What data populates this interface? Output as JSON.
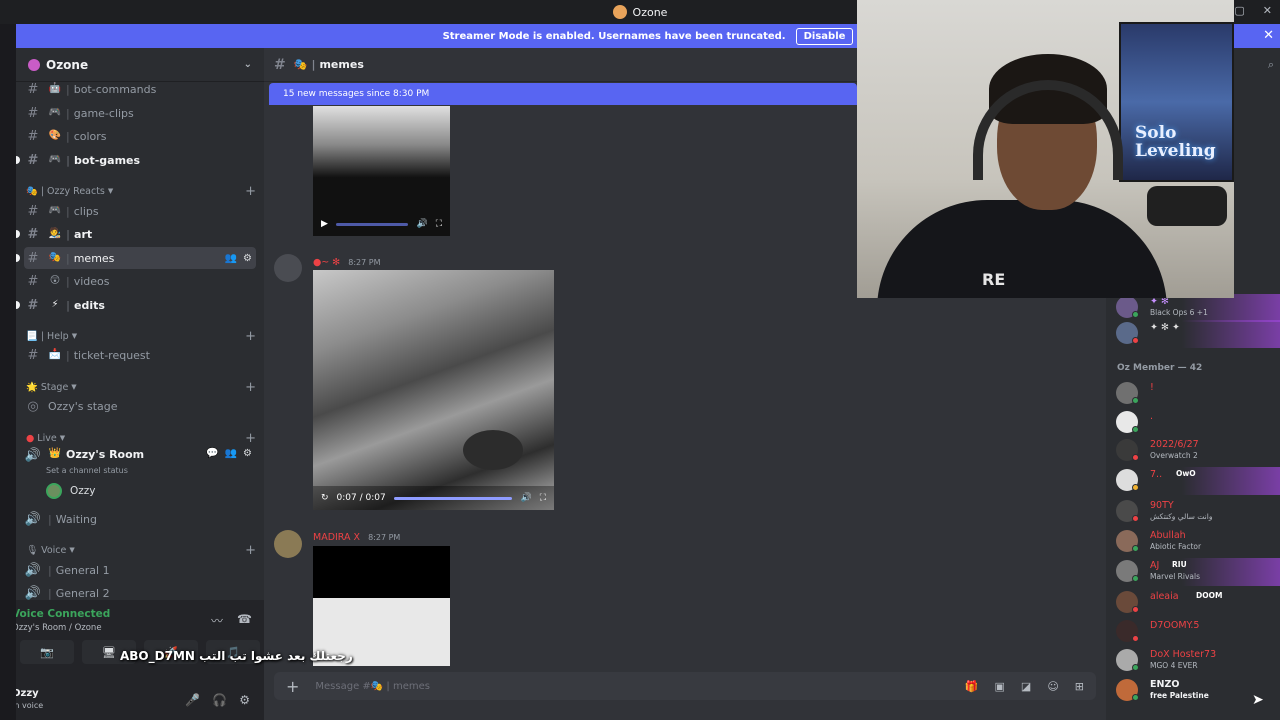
{
  "window": {
    "title": "Ozone"
  },
  "banner": {
    "text": "Streamer Mode is enabled. Usernames have been truncated.",
    "disable_label": "Disable"
  },
  "server": {
    "name": "Ozone"
  },
  "channels": {
    "bot_commands": "bot-commands",
    "game_clips": "game-clips",
    "colors": "colors",
    "bot_games": "bot-games",
    "cat_ozzy_reacts": "Ozzy Reacts",
    "clips": "clips",
    "art": "art",
    "memes": "memes",
    "videos": "videos",
    "edits": "edits",
    "cat_help": "Help",
    "ticket_request": "ticket-request",
    "cat_stage": "Stage",
    "ozzys_stage": "Ozzy's stage",
    "cat_live": "Live",
    "ozzys_room": "Ozzy's Room",
    "room_status": "Set a channel status",
    "voice_user": "Ozzy",
    "waiting": "Waiting",
    "cat_voice": "Voice",
    "general1": "General 1",
    "general2": "General 2"
  },
  "voice_panel": {
    "status": "Voice Connected",
    "location": "Ozzy's Room / Ozone",
    "user_name": "Ozzy",
    "user_status": "In voice"
  },
  "caption": "ABO_D7MN رجعتلك بعد عشوا تب التب",
  "chat": {
    "channel": "memes",
    "new_messages": "15 new messages since 8:30 PM",
    "msg1_time": "8:27 PM",
    "video1_time": "0:07 / 0:07",
    "msg2_author": "MADIRA X",
    "msg2_time": "8:27 PM",
    "composer_placeholder": "Message #🎭 | memes"
  },
  "members": {
    "section_header": "Oz Member — 42",
    "top1_activity": "Black Ops 6 +1",
    "list": [
      {
        "name": "!",
        "activity": ""
      },
      {
        "name": ".",
        "activity": ""
      },
      {
        "name": "2022/6/27",
        "activity": "Overwatch 2"
      },
      {
        "name": "7..",
        "activity": "",
        "badge": "OwO"
      },
      {
        "name": "90TY",
        "activity": "وانت سالي وكنتكش"
      },
      {
        "name": "Abullah",
        "activity": "Abiotic Factor"
      },
      {
        "name": "AJ",
        "activity": "Marvel Rivals",
        "badge": "RIU"
      },
      {
        "name": "aleaia",
        "activity": "",
        "badge": "DOOM"
      },
      {
        "name": "D7OOMY.5",
        "activity": ""
      },
      {
        "name": "DoX Hoster73",
        "activity": "MGO 4 EVER"
      },
      {
        "name": "ENZO",
        "activity": "free Palestine"
      }
    ]
  },
  "webcam": {
    "poster_line1": "Solo",
    "poster_line2": "Leveling",
    "shirt_logo": "RE"
  },
  "colors": {
    "accent": "#5865f2",
    "sidebar": "#2b2d31",
    "chat_bg": "#313338",
    "voice_green": "#3ba55c",
    "member_name_red": "#ed4245"
  }
}
